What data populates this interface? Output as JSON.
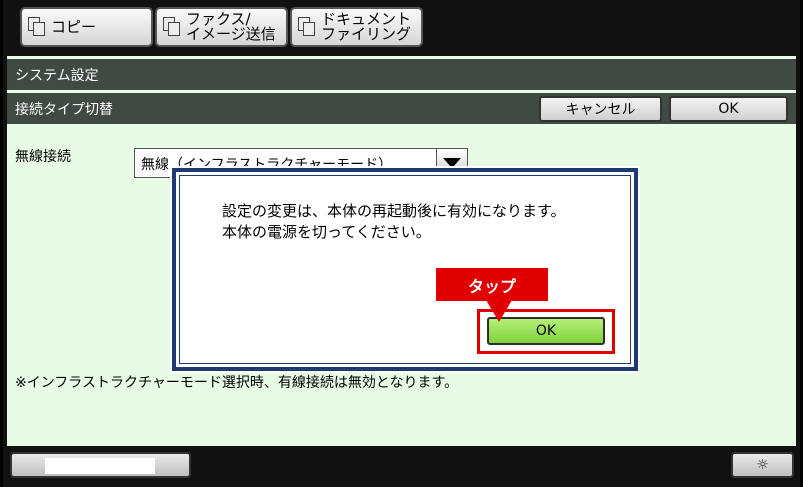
{
  "tabs": [
    {
      "label": "コピー",
      "icon": "copy-icon"
    },
    {
      "label_line1": "ファクス/",
      "label_line2": "イメージ送信",
      "icon": "fax-send-icon"
    },
    {
      "label_line1": "ドキュメント",
      "label_line2": "ファイリング",
      "icon": "document-filing-icon"
    }
  ],
  "header": {
    "title": "システム設定",
    "subtitle": "接続タイプ切替",
    "cancel_label": "キャンセル",
    "ok_label": "OK"
  },
  "form": {
    "field_label": "無線接続",
    "select_value": "無線（インフラストラクチャーモード）",
    "note": "※インフラストラクチャーモード選択時、有線接続は無効となります。"
  },
  "dialog": {
    "message_line1": "設定の変更は、本体の再起動後に有効になります。",
    "message_line2": "本体の電源を切ってください。",
    "ok_label": "OK"
  },
  "callout": {
    "label": "タップ",
    "color": "#e00000"
  },
  "footer": {
    "brightness_icon": "☼"
  },
  "colors": {
    "panel_bg": "#e8fbe6",
    "bar_bg": "#3e4a42",
    "dialog_border": "#1f3a6e",
    "ok_green": "#8fdc4a"
  }
}
